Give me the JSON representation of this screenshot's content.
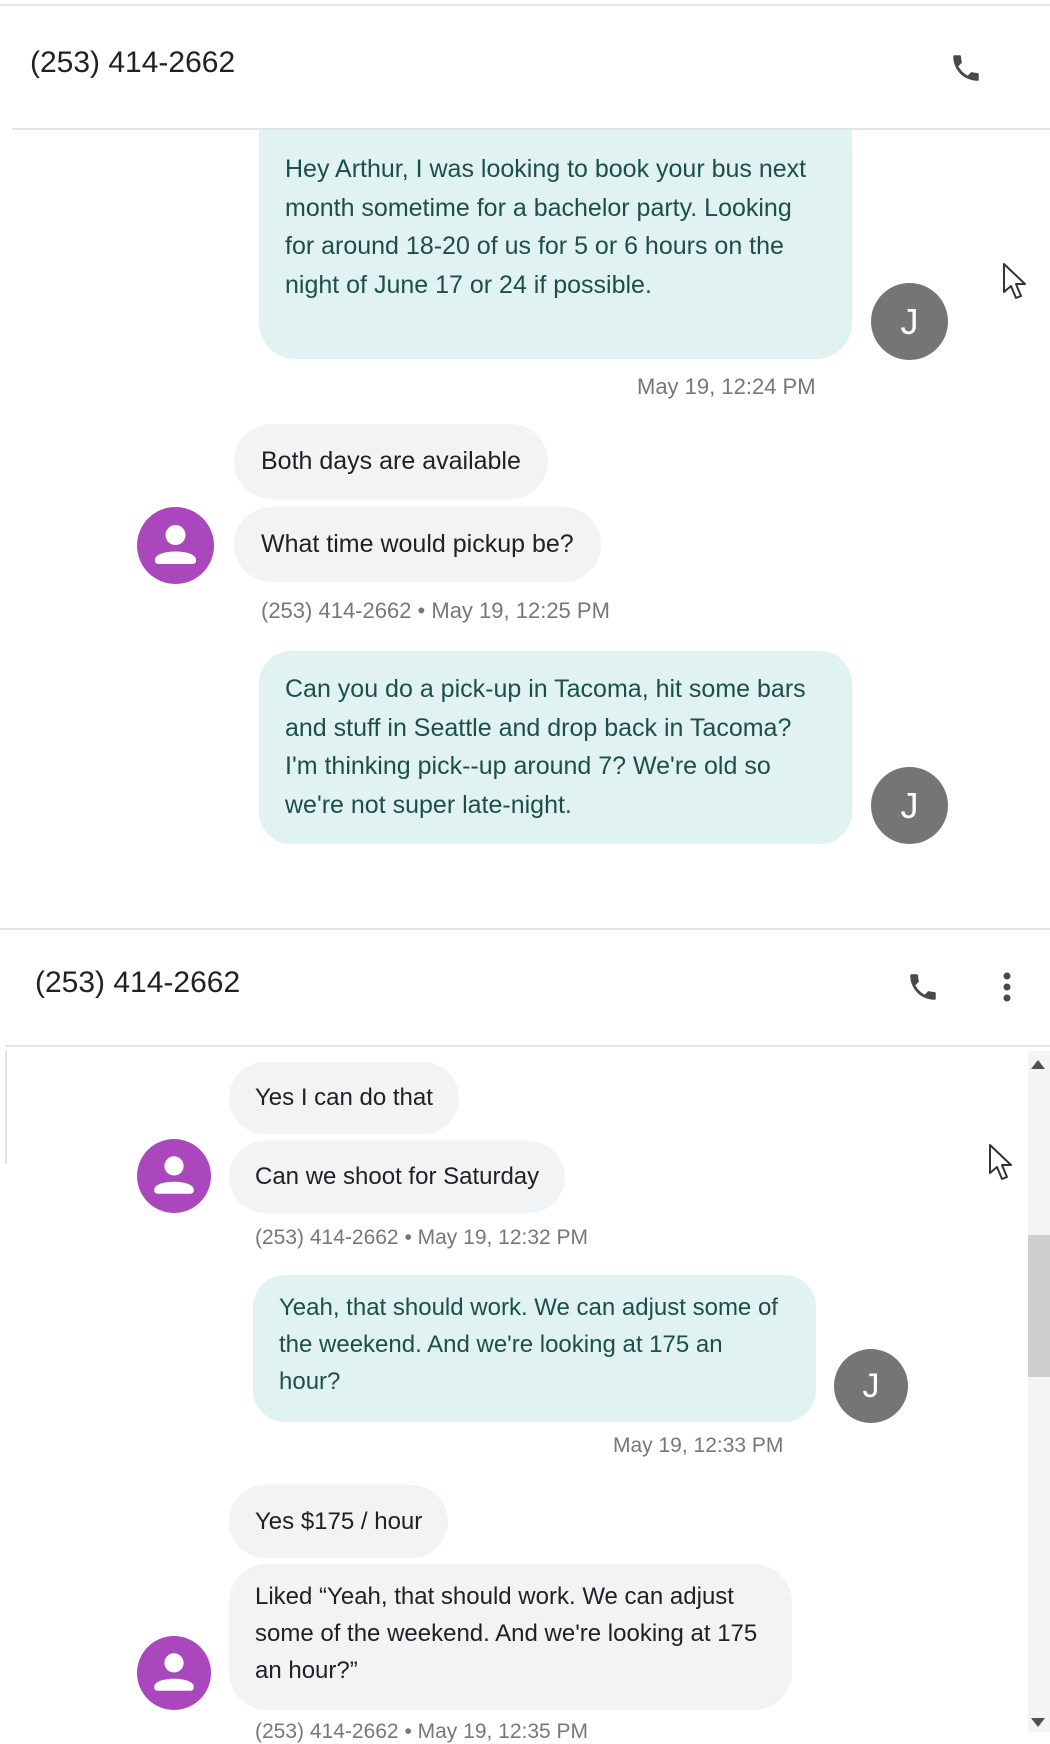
{
  "conversation_top": {
    "title": "(253) 414-2662",
    "icons": [
      "phone-icon"
    ],
    "messages": [
      {
        "text": "Hey Arthur, I was looking to book your bus next month sometime for a bachelor party. Looking for around 18-20 of us for 5 or 6 hours on the night of June 17 or 24 if possible.",
        "timestamp": "May 19, 12:24 PM",
        "avatar_letter": "J"
      },
      {
        "text": "Both days are available"
      },
      {
        "text": "What time would pickup be?",
        "meta": "(253) 414-2662 • May 19, 12:25 PM"
      },
      {
        "text": "Can you do a pick-up in Tacoma, hit some bars and stuff in Seattle and drop back in Tacoma? I'm thinking pick--up around 7? We're old so we're not super late-night.",
        "avatar_letter": "J"
      }
    ]
  },
  "conversation_bottom": {
    "title": "(253) 414-2662",
    "icons": [
      "phone-icon",
      "more-vert-icon"
    ],
    "messages": [
      {
        "text": "Yes I can do that"
      },
      {
        "text": "Can we shoot for Saturday",
        "meta": "(253) 414-2662 • May 19, 12:32 PM"
      },
      {
        "text": "Yeah, that should work. We can adjust some of the weekend. And we're looking at 175 an hour?",
        "timestamp": "May 19, 12:33 PM",
        "avatar_letter": "J"
      },
      {
        "text": "Yes $175 / hour"
      },
      {
        "text": "Liked “Yeah, that should work. We can adjust some of the weekend. And we're looking at 175 an hour?”",
        "meta": "(253) 414-2662 • May 19, 12:35 PM"
      }
    ]
  },
  "colors": {
    "outgoing_bubble": "#e0f2f1",
    "incoming_bubble": "#f1f3f4",
    "contact_avatar": "#ab47bc",
    "self_avatar": "#757575"
  }
}
